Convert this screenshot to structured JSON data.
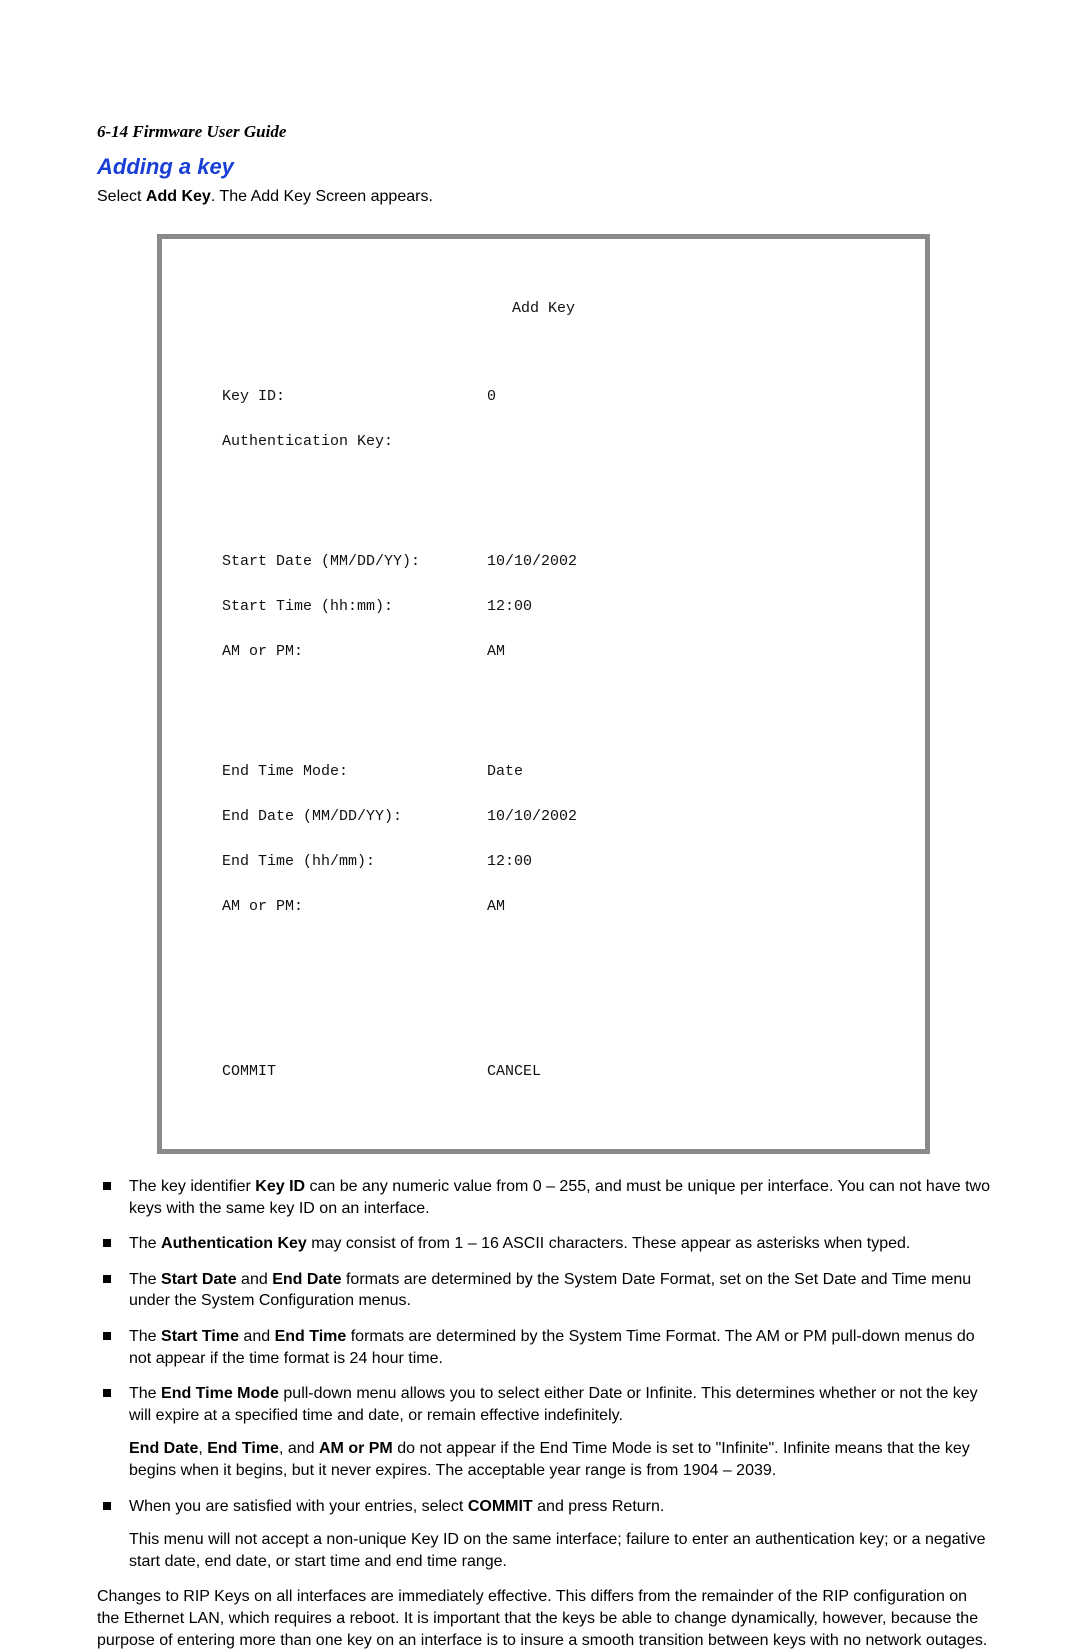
{
  "header": "6-14  Firmware User Guide",
  "sectionTitle": "Adding a key",
  "intro": {
    "pre": "Select ",
    "bold": "Add Key",
    "post": ". The Add Key Screen appears."
  },
  "terminal": {
    "title": "Add Key",
    "rows1": [
      {
        "label": "Key ID:",
        "value": "0"
      },
      {
        "label": "Authentication Key:",
        "value": ""
      }
    ],
    "rows2": [
      {
        "label": "Start Date (MM/DD/YY):",
        "value": "10/10/2002"
      },
      {
        "label": "Start Time (hh:mm):",
        "value": "12:00"
      },
      {
        "label": "AM or PM:",
        "value": "AM"
      }
    ],
    "rows3": [
      {
        "label": "End Time Mode:",
        "value": "Date"
      },
      {
        "label": "End Date (MM/DD/YY):",
        "value": "10/10/2002"
      },
      {
        "label": "End Time (hh/mm):",
        "value": "12:00"
      },
      {
        "label": "AM or PM:",
        "value": "AM"
      }
    ],
    "commit": "COMMIT",
    "cancel": "CANCEL"
  },
  "bullets": {
    "b1": {
      "t0": "The key identifier ",
      "t1": "Key ID",
      "t2": " can be any numeric value from 0 – 255, and must be unique per interface. You can not have two keys with the same key ID on an interface."
    },
    "b2": {
      "t0": "The ",
      "t1": "Authentication Key",
      "t2": " may consist of from 1 – 16 ASCII characters. These appear as asterisks when typed."
    },
    "b3": {
      "t0": "The ",
      "t1": "Start Date",
      "t2": " and ",
      "t3": "End Date",
      "t4": " formats are determined by the System Date Format, set on the Set Date and Time menu under the System Configuration menus."
    },
    "b4": {
      "t0": "The ",
      "t1": "Start Time",
      "t2": " and ",
      "t3": "End Time",
      "t4": " formats are determined by the System Time Format. The AM or PM pull-down menus do not appear if the time format is 24 hour time."
    },
    "b5": {
      "t0": "The ",
      "t1": "End Time Mode",
      "t2": " pull-down menu allows you to select either Date or Infinite. This determines whether or not the key will expire at a specified time and date, or remain effective indefinitely.",
      "sub": {
        "s1": "End Date",
        "s2": ", ",
        "s3": "End Time",
        "s4": ", and ",
        "s5": "AM or PM",
        "s6": " do not appear if the End Time Mode is set to \"Infinite\". Infinite means that the key begins when it begins, but it never expires. The acceptable year range is from 1904 – 2039."
      }
    },
    "b6": {
      "t0": "When you are satisfied with your entries, select ",
      "t1": "COMMIT",
      "t2": " and press Return.",
      "sub": "This menu will not accept a non-unique Key ID on the same interface; failure to enter an authentication key; or a negative start date, end date, or start time and end time range."
    }
  },
  "footer": "Changes to RIP Keys on all interfaces are immediately effective. This differs from the remainder of the RIP configuration on the Ethernet LAN, which requires a reboot. It is important that the keys be able to change dynamically, however, because the purpose of entering more than one key on an interface is to insure a smooth transition between keys with no network outages."
}
